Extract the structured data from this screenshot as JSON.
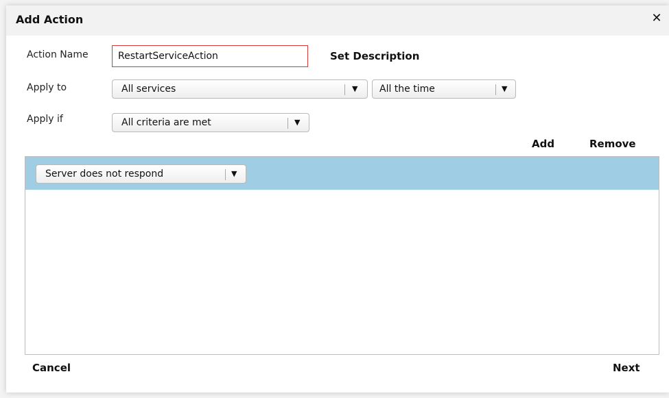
{
  "dialog": {
    "title": "Add Action",
    "close_icon": "close-icon"
  },
  "form": {
    "action_name_label": "Action Name",
    "action_name_value": "RestartServiceAction",
    "set_description_label": "Set Description",
    "apply_to_label": "Apply to",
    "apply_to_value": "All services",
    "apply_to_time_value": "All the time",
    "apply_if_label": "Apply if",
    "apply_if_value": "All criteria are met"
  },
  "criteria": {
    "add_label": "Add",
    "remove_label": "Remove",
    "rows": [
      {
        "condition": "Server does not respond"
      }
    ]
  },
  "footer": {
    "cancel_label": "Cancel",
    "next_label": "Next"
  },
  "colors": {
    "selected_row": "#9ecde4",
    "input_error_border": "#d43a3a"
  }
}
